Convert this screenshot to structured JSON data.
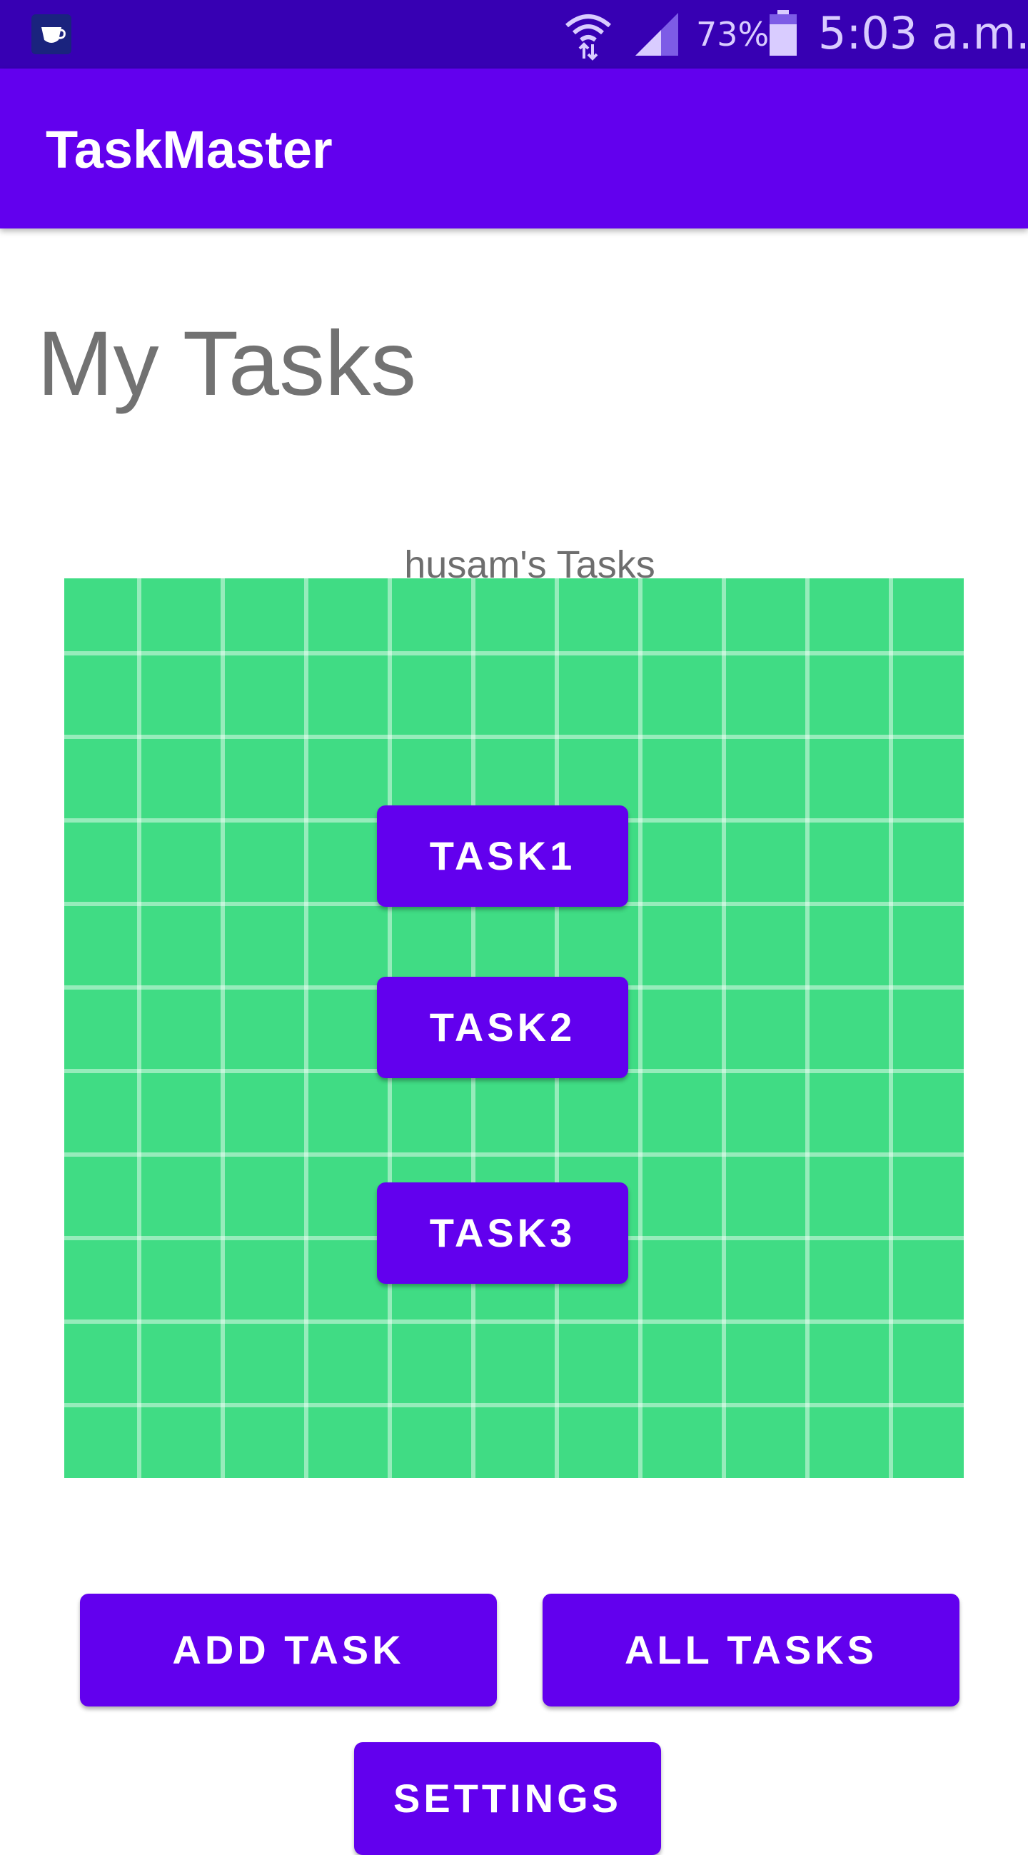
{
  "status_bar": {
    "battery_percent": "73%",
    "time": "5:03 a.m.",
    "icons": [
      "app-notification-icon",
      "wifi-icon",
      "cell-signal-icon",
      "battery-icon"
    ]
  },
  "app_bar": {
    "title": "TaskMaster"
  },
  "main": {
    "heading": "My Tasks",
    "user_tasks_label": "husam's Tasks",
    "tasks": [
      {
        "label": "TASK1"
      },
      {
        "label": "TASK2"
      },
      {
        "label": "TASK3"
      }
    ]
  },
  "actions": {
    "add_task": "ADD TASK",
    "all_tasks": "ALL TASKS",
    "settings": "SETTINGS"
  },
  "colors": {
    "status_bar": "#3700b3",
    "primary": "#6200ee",
    "task_area": "#40dc84",
    "heading_text": "#727272"
  }
}
